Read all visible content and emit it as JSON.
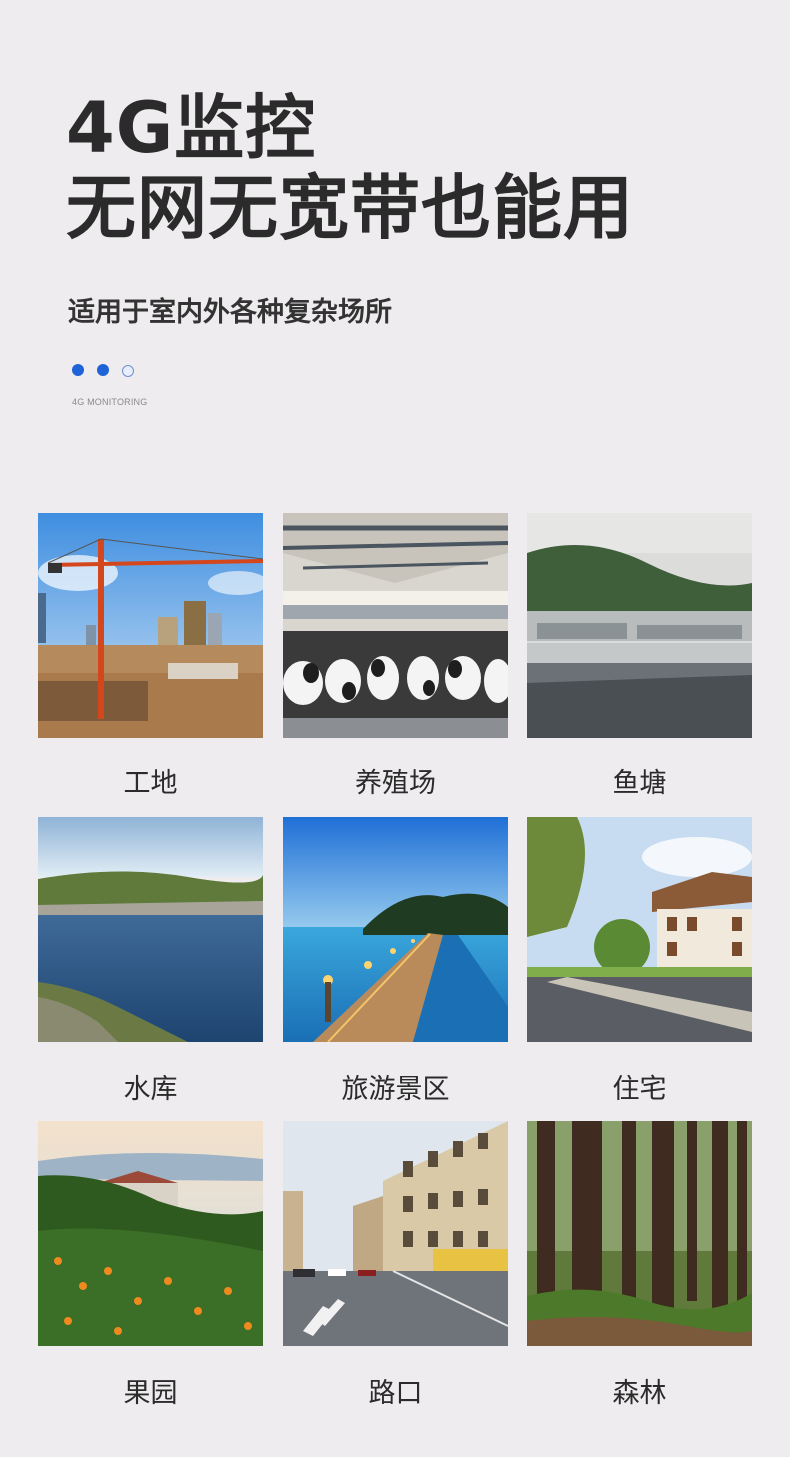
{
  "header": {
    "title_line1": "4G监控",
    "title_line2": "无网无宽带也能用",
    "subtitle": "适用于室内外各种复杂场所",
    "tagline": "4G MONITORING"
  },
  "scenes": [
    {
      "label": "工地"
    },
    {
      "label": "养殖场"
    },
    {
      "label": "鱼塘"
    },
    {
      "label": "水库"
    },
    {
      "label": "旅游景区"
    },
    {
      "label": "住宅"
    },
    {
      "label": "果园"
    },
    {
      "label": "路口"
    },
    {
      "label": "森林"
    }
  ],
  "colors": {
    "background": "#eeecee",
    "title": "#2b2b2b",
    "accent_dot": "#1f63d8"
  }
}
